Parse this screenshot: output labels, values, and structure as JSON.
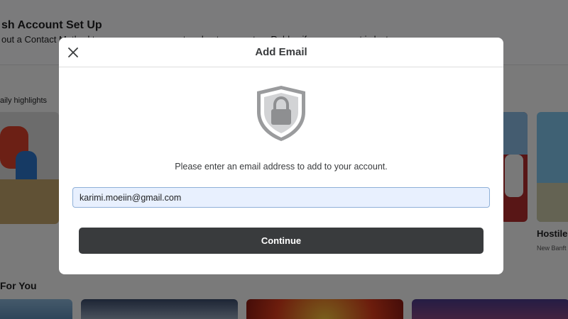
{
  "background": {
    "banner_title": "sh Account Set Up",
    "banner_subtitle": "out a Contact Method to secure your account and get access to a Roblox if your account is lost.",
    "section_label": "aily highlights",
    "game_title": "Hostile",
    "game_subtitle": "New Banft",
    "for_you_label": "For You"
  },
  "modal": {
    "title": "Add Email",
    "instruction": "Please enter an email address to add to your account.",
    "email_value": "karimi.moeiin@gmail.com",
    "continue_label": "Continue",
    "icons": {
      "close": "close-icon",
      "shield": "shield-lock-icon"
    }
  },
  "colors": {
    "button_bg": "#393b3d",
    "input_bg": "#e8f0fe",
    "input_border": "#8fb0d8"
  }
}
